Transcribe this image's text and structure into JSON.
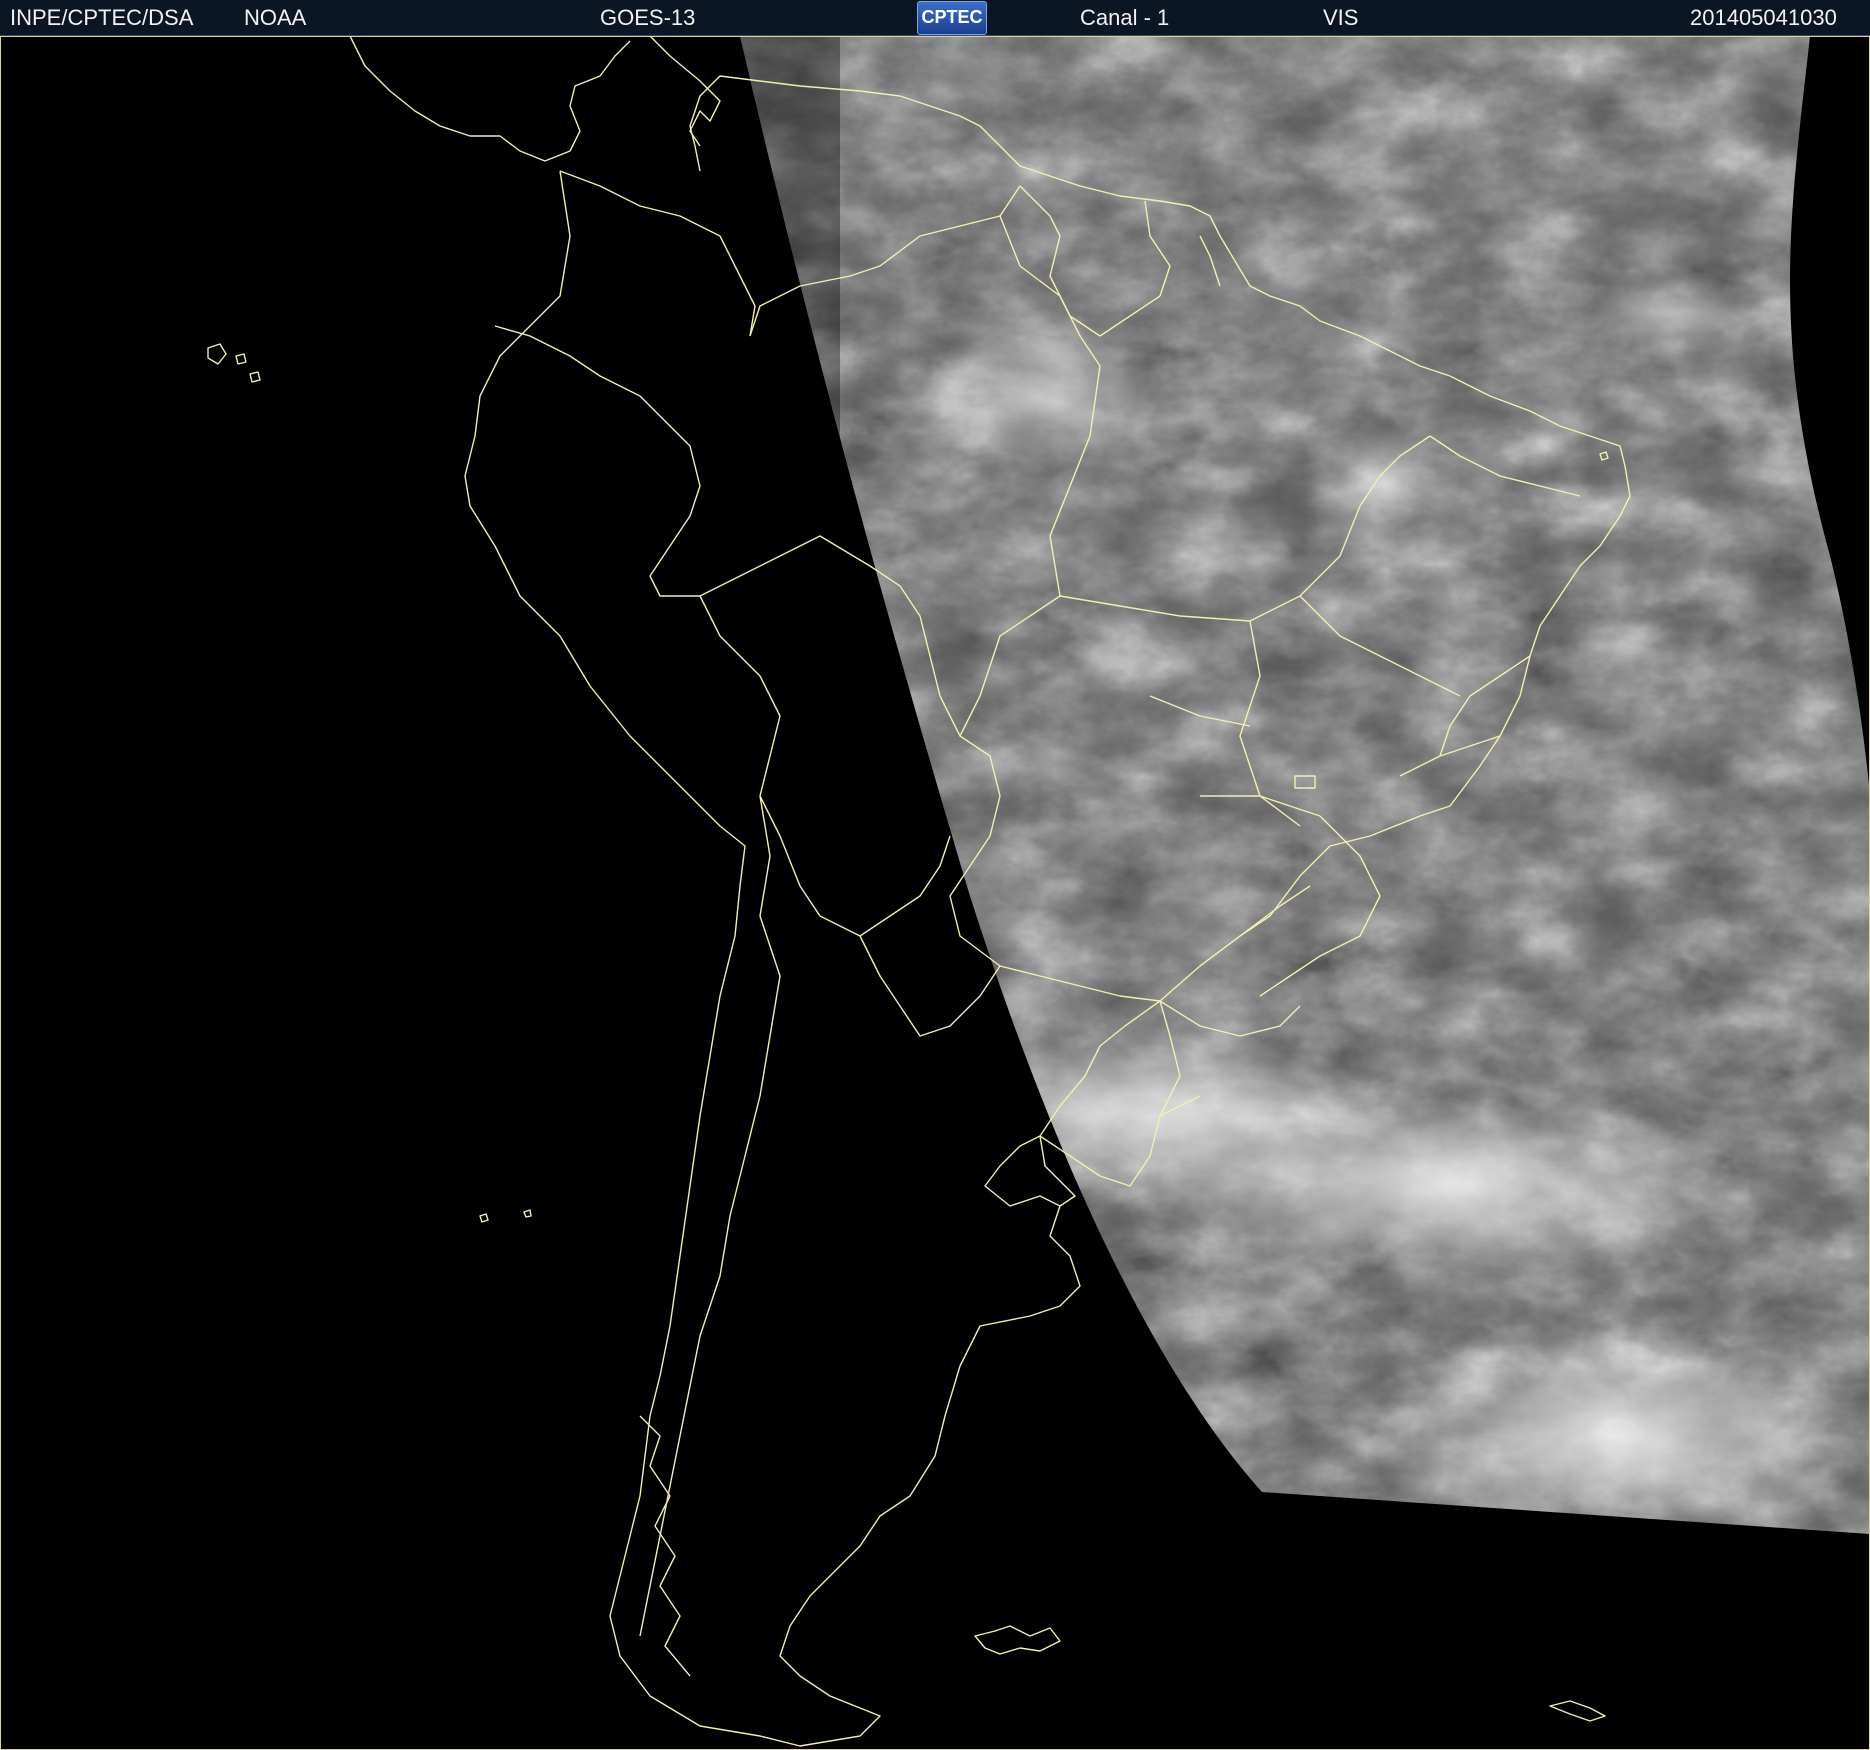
{
  "header": {
    "org": "INPE/CPTEC/DSA",
    "agency": "NOAA",
    "satellite": "GOES-13",
    "logo_text": "CPTEC",
    "channel": "Canal - 1",
    "band": "VIS",
    "timestamp": "201405041030"
  },
  "colors": {
    "header_bg": "#0b1624",
    "coastline": "#f2eeb4",
    "background": "#000000",
    "cloud_bright": "#f0f0f0",
    "cloud_dark": "#3a3a3a"
  }
}
